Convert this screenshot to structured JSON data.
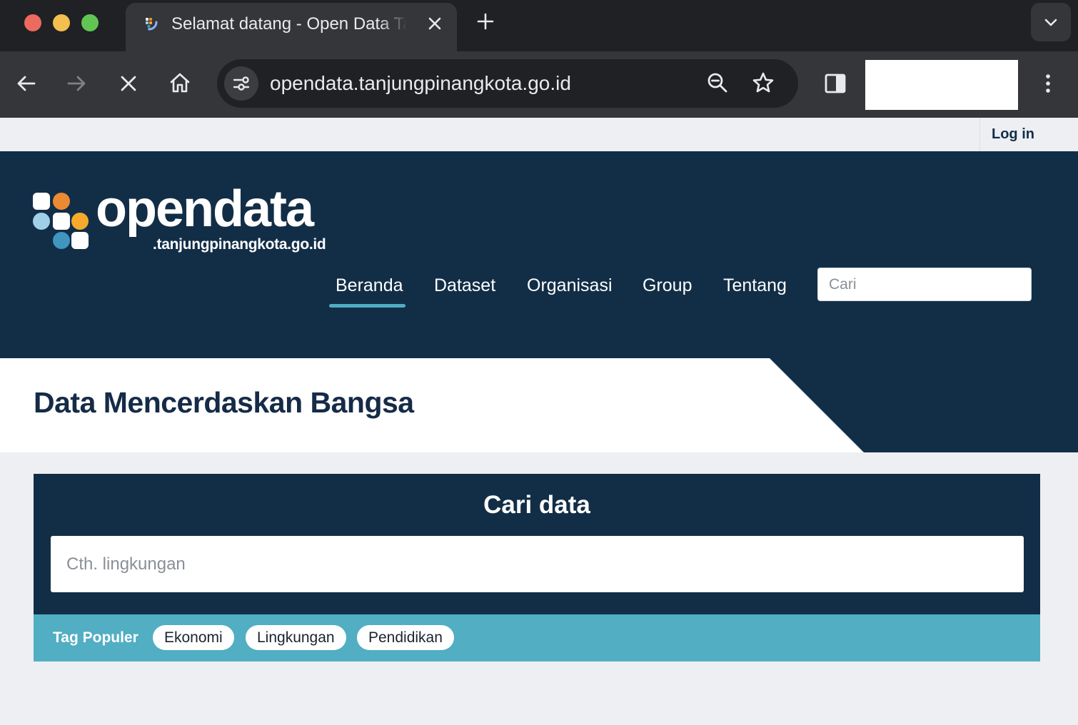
{
  "browser": {
    "tab_title": "Selamat datang - Open Data Tanjungpinang",
    "url": "opendata.tanjungpinangkota.go.id",
    "icons": {
      "back": "arrow-left-icon",
      "forward": "arrow-right-icon",
      "stop": "close-icon",
      "home": "home-icon",
      "zoom": "zoom-out-icon",
      "bookmark": "star-icon",
      "side_panel": "side-panel-icon",
      "menu": "kebab-menu-icon"
    }
  },
  "account": {
    "login_label": "Log in"
  },
  "logo": {
    "word": "opendata",
    "domain": ".tanjungpinangkota.go.id",
    "colors": {
      "white": "#ffffff",
      "orange": "#ec8a32",
      "light_blue": "#9fd0e8",
      "yellow": "#f5aa2b",
      "teal": "#3f96bf"
    }
  },
  "nav": {
    "items": [
      {
        "label": "Beranda",
        "active": true
      },
      {
        "label": "Dataset",
        "active": false
      },
      {
        "label": "Organisasi",
        "active": false
      },
      {
        "label": "Group",
        "active": false
      },
      {
        "label": "Tentang",
        "active": false
      }
    ],
    "search_placeholder": "Cari"
  },
  "hero": {
    "title": "Data Mencerdaskan Bangsa"
  },
  "search": {
    "title": "Cari data",
    "placeholder": "Cth. lingkungan"
  },
  "tags": {
    "label": "Tag Populer",
    "items": [
      "Ekonomi",
      "Lingkungan",
      "Pendidikan"
    ]
  },
  "colors": {
    "navy": "#122e47",
    "accent": "#51aec3",
    "page_bg": "#eeeff3",
    "title_text": "#152b47"
  }
}
